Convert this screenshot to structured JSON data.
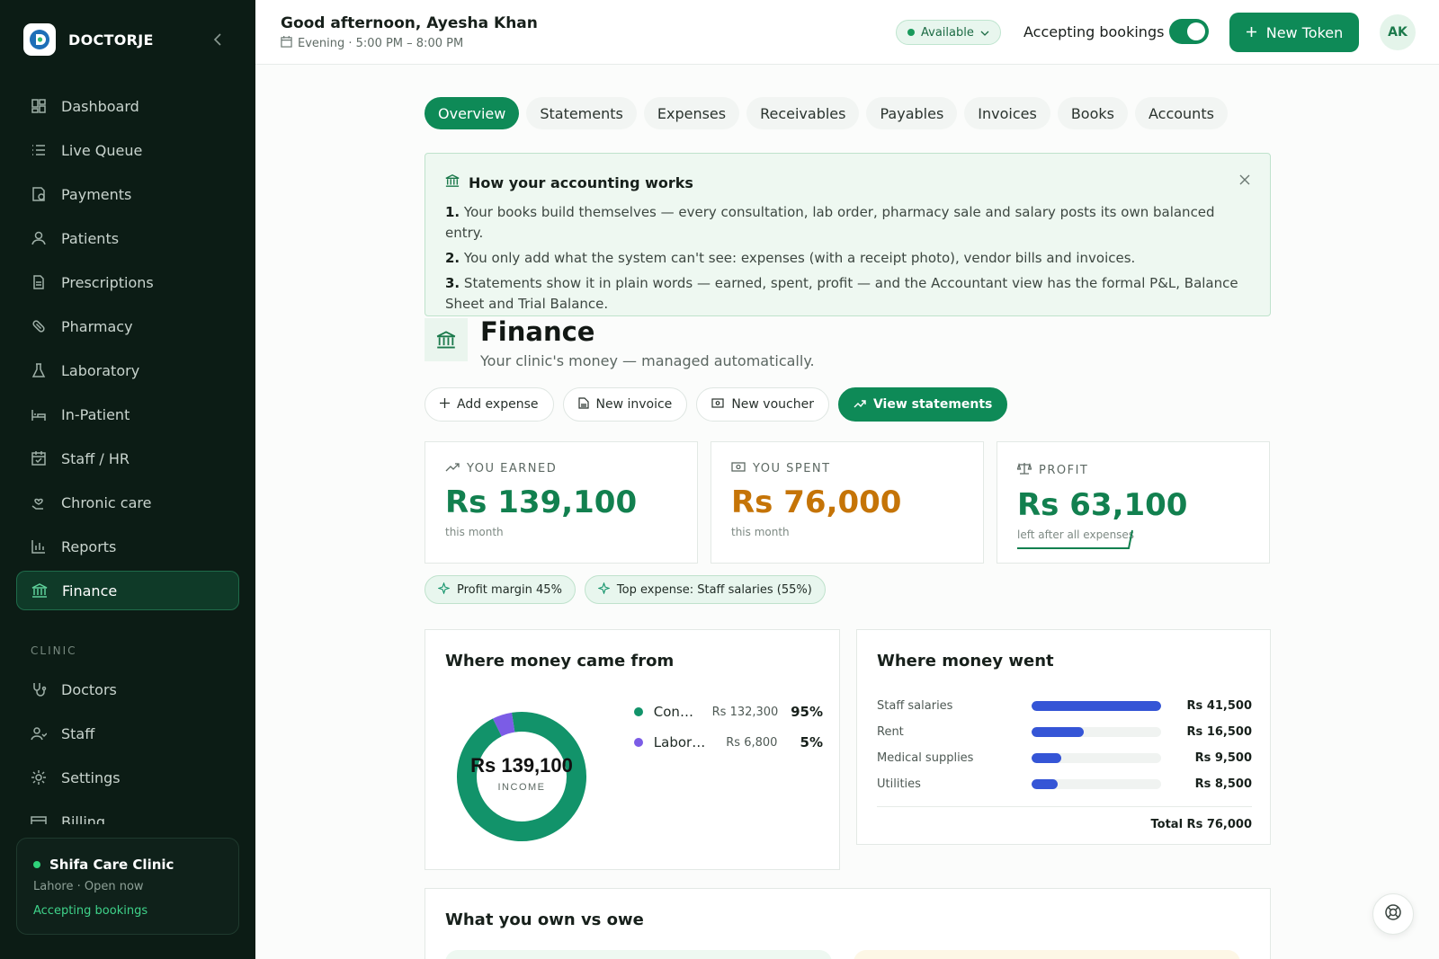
{
  "brand": {
    "name": "DOCTORJE"
  },
  "sidebar": {
    "items": [
      {
        "label": "Dashboard",
        "icon": "dashboard-icon"
      },
      {
        "label": "Live Queue",
        "icon": "list-icon"
      },
      {
        "label": "Payments",
        "icon": "payments-icon"
      },
      {
        "label": "Patients",
        "icon": "user-icon"
      },
      {
        "label": "Prescriptions",
        "icon": "document-icon"
      },
      {
        "label": "Pharmacy",
        "icon": "pill-icon"
      },
      {
        "label": "Laboratory",
        "icon": "flask-icon"
      },
      {
        "label": "In-Patient",
        "icon": "bed-icon"
      },
      {
        "label": "Staff / HR",
        "icon": "calendar-icon"
      },
      {
        "label": "Chronic care",
        "icon": "heart-hand-icon"
      },
      {
        "label": "Reports",
        "icon": "bar-chart-icon"
      },
      {
        "label": "Finance",
        "icon": "bank-icon",
        "active": true
      }
    ],
    "section_label": "CLINIC",
    "clinic_items": [
      {
        "label": "Doctors",
        "icon": "stethoscope-icon"
      },
      {
        "label": "Staff",
        "icon": "staff-icon"
      },
      {
        "label": "Settings",
        "icon": "gear-icon"
      },
      {
        "label": "Billing",
        "icon": "card-icon"
      }
    ],
    "clinic": {
      "name": "Shifa Care Clinic",
      "sub": "Lahore · Open now",
      "status": "Accepting bookings"
    }
  },
  "topbar": {
    "greeting": "Good afternoon, Ayesha Khan",
    "shift": "Evening · 5:00 PM – 8:00 PM",
    "availability": "Available",
    "accepting_label": "Accepting bookings",
    "new_token_label": "New Token",
    "avatar_initials": "AK"
  },
  "tabs": [
    "Overview",
    "Statements",
    "Expenses",
    "Receivables",
    "Payables",
    "Invoices",
    "Books",
    "Accounts"
  ],
  "info": {
    "title": "How your accounting works",
    "steps": [
      {
        "num": "1.",
        "text": "Your books build themselves — every consultation, lab order, pharmacy sale and salary posts its own balanced entry."
      },
      {
        "num": "2.",
        "text": "You only add what the system can't see: expenses (with a receipt photo), vendor bills and invoices."
      },
      {
        "num": "3.",
        "text": "Statements show it in plain words — earned, spent, profit — and the Accountant view has the formal P&L, Balance Sheet and Trial Balance."
      }
    ]
  },
  "finance": {
    "title": "Finance",
    "subtitle": "Your clinic's money — managed automatically.",
    "actions": {
      "add_expense": "Add expense",
      "new_invoice": "New invoice",
      "new_voucher": "New voucher",
      "view_statements": "View statements"
    }
  },
  "kpis": {
    "earned": {
      "label": "YOU EARNED",
      "value": "Rs 139,100",
      "sub": "this month"
    },
    "spent": {
      "label": "YOU SPENT",
      "value": "Rs 76,000",
      "sub": "this month"
    },
    "profit": {
      "label": "PROFIT",
      "value": "Rs 63,100",
      "sub": "left after all expenses"
    }
  },
  "pills": {
    "margin": "Profit margin 45%",
    "top_expense": "Top expense: Staff salaries (55%)"
  },
  "income": {
    "title": "Where money came from",
    "total": "Rs 139,100",
    "total_label": "INCOME",
    "rows": [
      {
        "name": "Consultations",
        "amount": "Rs 132,300",
        "pct": "95%",
        "color": "#12936a"
      },
      {
        "name": "Laboratory",
        "amount": "Rs 6,800",
        "pct": "5%",
        "color": "#7b5ce6"
      }
    ]
  },
  "spend": {
    "title": "Where money went",
    "rows": [
      {
        "name": "Staff salaries",
        "amount": "Rs 41,500",
        "fraction": 1.0
      },
      {
        "name": "Rent",
        "amount": "Rs 16,500",
        "fraction": 0.4
      },
      {
        "name": "Medical supplies",
        "amount": "Rs 9,500",
        "fraction": 0.23
      },
      {
        "name": "Utilities",
        "amount": "Rs 8,500",
        "fraction": 0.2
      }
    ],
    "total": "Total Rs 76,000"
  },
  "own": {
    "title": "What you own vs owe"
  },
  "colors": {
    "primary": "#0e8a57",
    "sidebar_bg": "#0c1c15",
    "earned": "#12804f",
    "spent": "#c57407",
    "bar": "#3555d6"
  },
  "chart_data": {
    "type": "pie",
    "categories": [
      "Consultations",
      "Laboratory"
    ],
    "values": [
      132300,
      6800
    ],
    "title": "Where money came from"
  }
}
